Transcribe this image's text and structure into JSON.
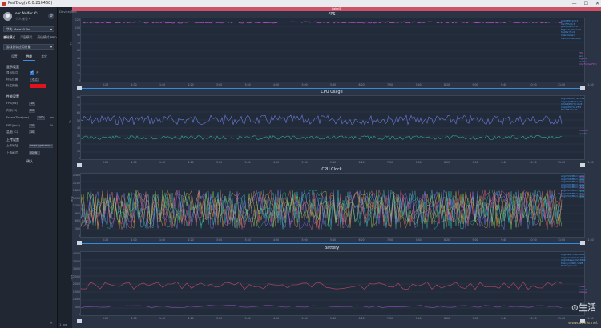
{
  "window": {
    "title": "PerfDog(v6.0.210468)",
    "controls": [
      "—",
      "☐",
      "✕"
    ]
  },
  "sidebar": {
    "user": {
      "name": "ser Nolfer ©",
      "sub": "个人帐号 ▾",
      "gear": "⚙"
    },
    "device_select": "华为 Mate30 Pro",
    "app_select": "游戏测试应用性能",
    "tabs": [
      "基础模式",
      "浮窗模式",
      "高级模式 PRO"
    ],
    "tabs2": [
      "设置",
      "性能",
      "其它"
    ],
    "sections": {
      "display": "显示设置",
      "perf": "性能设置",
      "upload": "上传设置"
    },
    "rows": [
      {
        "label": "显示标注",
        "value": "",
        "check": true,
        "extra": "开"
      },
      {
        "label": "标注位置",
        "value": "右上",
        "unit": ""
      },
      {
        "label": "标注颜色",
        "value": ""
      },
      {
        "label": "FPS(Hz)",
        "value": "10"
      },
      {
        "label": "内存(M)",
        "value": "20"
      },
      {
        "label": "FrameTime(ms)",
        "value": "100",
        "unit": "ms"
      },
      {
        "label": "FPS(Jank)",
        "value": "10",
        "unit": "%"
      },
      {
        "label": "温度(°C)",
        "value": "10"
      },
      {
        "label": "上传地址",
        "value": "https://perfdog.q"
      },
      {
        "label": "上传格式",
        "value": "JSON"
      }
    ],
    "apply_button": "确认",
    "collapse": "«"
  },
  "gutter": {
    "top": "Device/Test",
    "bottom": "1 log"
  },
  "timeline": {
    "label": "Label1"
  },
  "panels": [
    {
      "title": "FPS",
      "ylabel": "FPS",
      "yticks": [
        "120",
        "105",
        "90",
        "75",
        "60",
        "45",
        "30",
        "15",
        "0"
      ],
      "legend": [
        "Avg(FPS):119.7",
        "Var(FPS):0.3",
        "Jank(/10min):0",
        "BigJank(/10min):0",
        "Stutter(%):0",
        "InterFrame:0",
        "FrameTime(ms):8"
      ],
      "legend2": [
        "FPS",
        "Jank",
        "BigJank",
        "Stutter",
        "InterFrame(FPS)"
      ]
    },
    {
      "title": "CPU Usage",
      "ylabel": "%",
      "yticks": [
        "80",
        "70",
        "60",
        "50",
        "40",
        "30",
        "20",
        "10",
        "0"
      ],
      "legend": [
        "AvgTotalCPU(%):34.9",
        "AvgAppCPU(%):19.2",
        "CTotalCPU(%):43.8",
        "CAppCPU(%):23.5",
        "MaxCPU(%):61.4"
      ],
      "legend2": [
        "TotalCPU",
        "AppCPU"
      ]
    },
    {
      "title": "CPU Clock",
      "ylabel": "MHz",
      "yticks": [
        "2,400",
        "2,100",
        "1,800",
        "1,500",
        "1,200",
        "900",
        "600",
        "300",
        "0"
      ],
      "legend": [
        "AvgCPU0(MHz):1004",
        "AvgCPU1(MHz):1004",
        "AvgCPU2(MHz):1004",
        "AvgCPU3(MHz):1004",
        "AvgCPU4(MHz):1329",
        "AvgCPU5(MHz):1329",
        "AvgCPU6(MHz):1551",
        "AvgCPU7(MHz):1551"
      ],
      "legend2": [
        "CPU0",
        "CPU1",
        "CPU2",
        "CPU3",
        "CPU4",
        "CPU5",
        "CPU6",
        "CPU7"
      ]
    },
    {
      "title": "Battery",
      "ylabel": "mW",
      "yticks": [
        "4,000",
        "3,500",
        "3,000",
        "2,500",
        "2,000",
        "1,500",
        "1,000",
        "500",
        "0"
      ],
      "legend": [
        "AvgPower(mW):3860",
        "AvgCurrent(mA):1052",
        "AvgVoltage(mV):3804",
        "Energy(mWh):1028",
        "Battery(%):92"
      ],
      "legend2": [
        "Power",
        "Current",
        "Voltage"
      ]
    }
  ],
  "xticks": [
    "0:25",
    "1:00",
    "1:40",
    "2:20",
    "3:00",
    "3:40",
    "4:20",
    "5:00",
    "5:40",
    "6:20",
    "7:00",
    "7:40",
    "8:20",
    "9:00",
    "9:40",
    "10:20",
    "11:00",
    "11:40"
  ],
  "colors": {
    "fps": "#c455d6",
    "fpsLine2": "#4aa3ff",
    "cpuTotal": "#6b7fe0",
    "cpuApp": "#2fae8f",
    "battery": "#c14b6b",
    "battery2": "#8a4fb0",
    "scroll": "#2b8de0",
    "timeline": "#cf5267"
  },
  "watermark": {
    "main": "⊙生活",
    "sub": "www.aelife.net"
  }
}
